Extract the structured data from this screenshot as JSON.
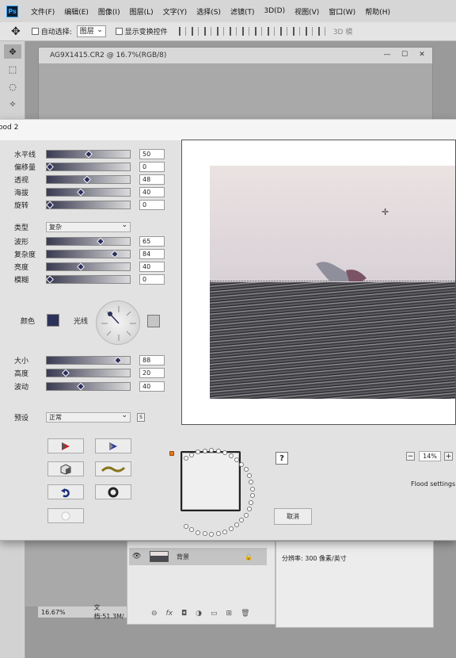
{
  "app": {
    "logo": "Ps"
  },
  "menu": [
    "文件(F)",
    "编辑(E)",
    "图像(I)",
    "图层(L)",
    "文字(Y)",
    "选择(S)",
    "滤镜(T)",
    "3D(D)",
    "视图(V)",
    "窗口(W)",
    "帮助(H)"
  ],
  "options": {
    "auto_select_label": "自动选择:",
    "auto_select_value": "图层",
    "show_transform_label": "显示变换控件",
    "mode_3d": "3D 模"
  },
  "document": {
    "title": "AG9X1415.CR2 @ 16.7%(RGB/8)"
  },
  "dialog": {
    "title": "ood 2",
    "params": [
      {
        "label": "水平线",
        "value": "50",
        "level": 0.5
      },
      {
        "label": "偏移量",
        "value": "0",
        "level": 0.0
      },
      {
        "label": "透视",
        "value": "48",
        "level": 0.48
      },
      {
        "label": "海拔",
        "value": "40",
        "level": 0.4
      },
      {
        "label": "旋转",
        "value": "0",
        "level": 0.0
      }
    ],
    "type_label": "类型",
    "type_value": "复杂",
    "wave_params": [
      {
        "label": "波形",
        "value": "65",
        "level": 0.65
      },
      {
        "label": "复杂度",
        "value": "84",
        "level": 0.84
      },
      {
        "label": "亮度",
        "value": "40",
        "level": 0.4
      },
      {
        "label": "模糊",
        "value": "0",
        "level": 0.0
      }
    ],
    "color_label": "颜色",
    "light_label": "光线",
    "colors": {
      "water": "#2d3358",
      "light": "#c5c5c5"
    },
    "size_params": [
      {
        "label": "大小",
        "value": "88",
        "level": 0.88
      },
      {
        "label": "高度",
        "value": "20",
        "level": 0.2
      },
      {
        "label": "波动",
        "value": "40",
        "level": 0.4
      }
    ],
    "preset_label": "预设",
    "preset_value": "正常",
    "save_preset_label": "S",
    "help_label": "?",
    "cancel_label": "取消",
    "zoom_minus": "−",
    "zoom_value": "14%",
    "zoom_plus": "+",
    "flood_settings": "Flood settings"
  },
  "layers": {
    "layer_name": "背景",
    "resolution": "分辨率: 300 像素/英寸"
  },
  "status": {
    "zoom": "16.67%",
    "doc": "文档:51.3M/"
  }
}
